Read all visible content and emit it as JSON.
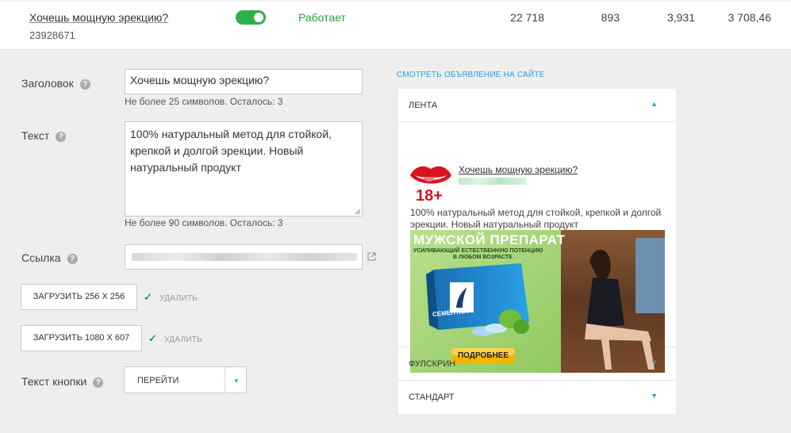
{
  "ad_row": {
    "title": "Хочешь мощную эрекцию?",
    "id": "23928671",
    "status": "Работает",
    "stats": [
      "22 718",
      "893",
      "3,931",
      "3 708,46"
    ]
  },
  "form": {
    "title_label": "Заголовок",
    "title_value": "Хочешь мощную эрекцию?",
    "title_hint": "Не более 25 символов. Осталось: 3",
    "text_label": "Текст",
    "text_value": "100% натуральный метод для стойкой, крепкой и долгой эрекции. Новый натуральный продукт",
    "text_hint": "Не более 90 символов. Осталось: 3",
    "link_label": "Ссылка",
    "upload_small": "ЗАГРУЗИТЬ 256 X 256",
    "upload_large": "ЗАГРУЗИТЬ 1080 X 607",
    "delete_label": "УДАЛИТЬ",
    "button_text_label": "Текст кнопки",
    "button_text_value": "ПЕРЕЙТИ",
    "help_glyph": "?"
  },
  "preview": {
    "view_link": "СМОТРЕТЬ ОБЪЯВЛЕНИЕ НА САЙТЕ",
    "sections": [
      "ЛЕНТА",
      "ФУЛСКРИН",
      "СТАНДАРТ"
    ],
    "feed_title": "Хочешь мощную эрекцию?",
    "feed_text": "100% натуральный метод для стойкой, крепкой и долгой эрекции. Новый натуральный продукт",
    "avatar_badge": "18+",
    "banner_headline": "МУЖСКОЙ ПРЕПАРАТ",
    "banner_subline1": "УСИЛИВАЮЩИЙ ЕСТЕСТВЕННУЮ ПОТЕНЦИЮ",
    "banner_subline2": "В ЛЮБОМ ВОЗРАСТЕ",
    "banner_brand": "СЕМЕНТАЛ",
    "banner_cta": "ПОДРОБНЕЕ"
  },
  "colors": {
    "accent": "#2a9fd6",
    "success": "#2aa03f",
    "toggle_on": "#2ab24a"
  },
  "icons": {
    "toggle": "toggle-switch-on",
    "help": "question-circle-icon",
    "external": "external-link-icon",
    "check": "check-icon",
    "collapse": "caret-up-icon",
    "expand": "caret-down-icon"
  }
}
